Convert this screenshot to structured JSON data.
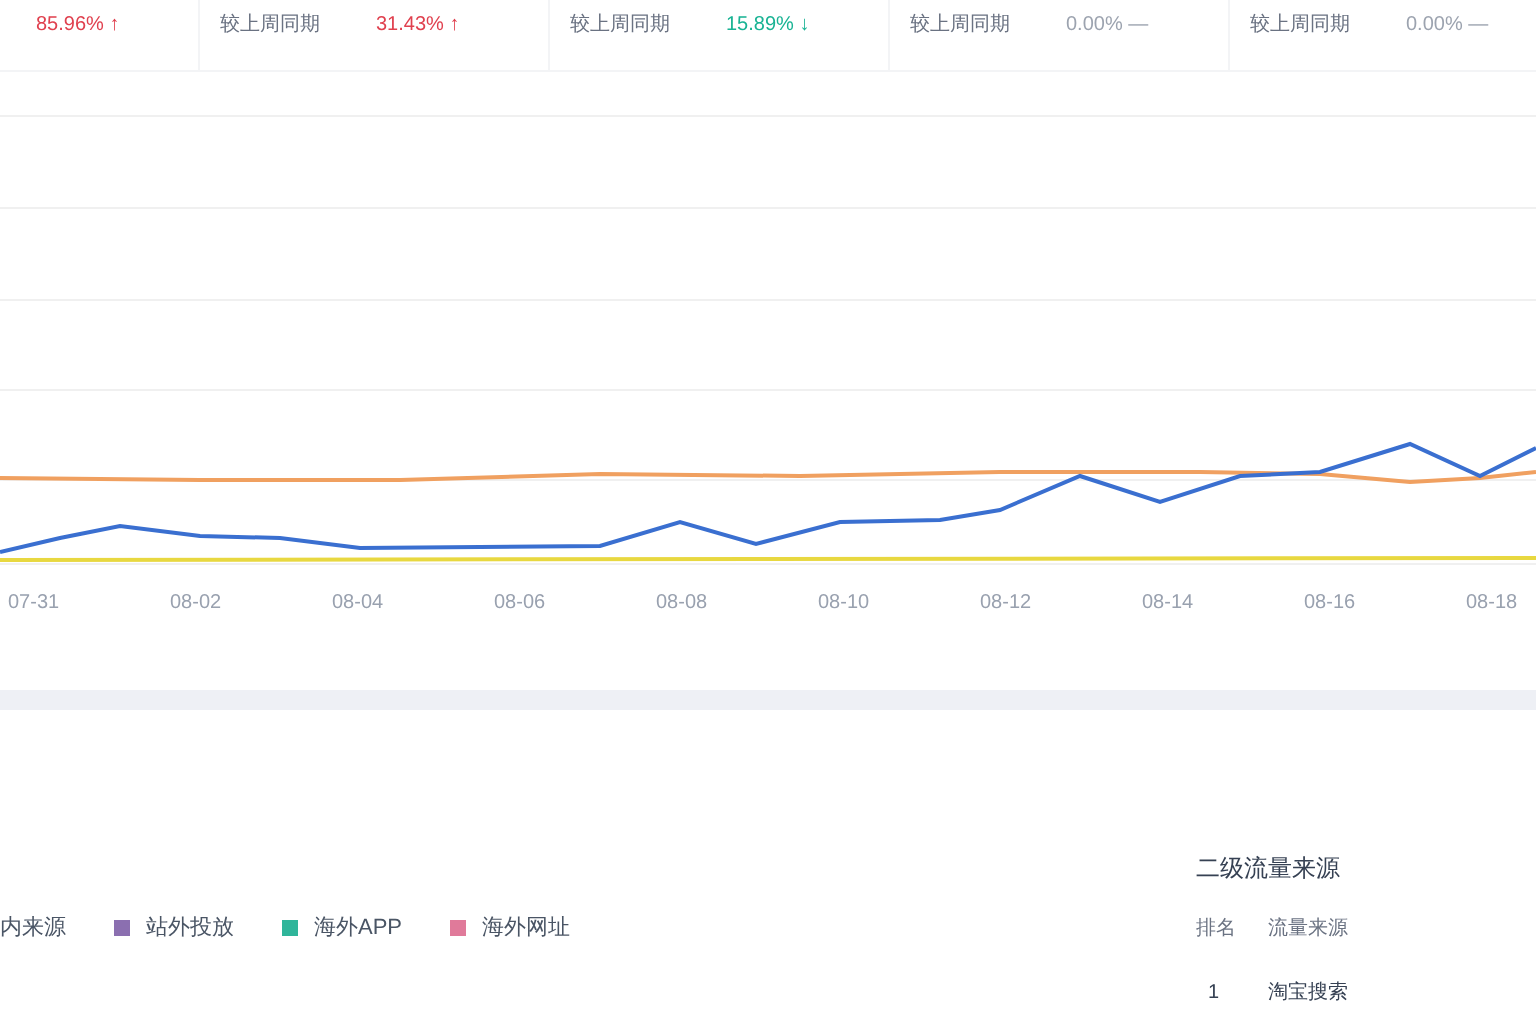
{
  "stat_cards": [
    {
      "change": "85.96%",
      "arrow": "↑",
      "color": "#e0414f"
    },
    {
      "label": "较上周同期",
      "change": "31.43%",
      "arrow": "↑",
      "color": "#e0414f"
    },
    {
      "label": "较上周同期",
      "change": "15.89%",
      "arrow": "↓",
      "color": "#19b394"
    },
    {
      "label": "较上周同期",
      "change": "0.00%",
      "arrow": "—",
      "color": "#9ca3af"
    },
    {
      "label": "较上周同期",
      "change": "0.00%",
      "arrow": "—",
      "color": "#9ca3af"
    }
  ],
  "trend_chart": {
    "x_labels": [
      "07-31",
      "08-02",
      "08-04",
      "08-06",
      "08-08",
      "08-10",
      "08-12",
      "08-14",
      "08-16",
      "08-18"
    ]
  },
  "legend": [
    {
      "label": "内来源"
    },
    {
      "label": "站外投放",
      "color": "#8b6fb0"
    },
    {
      "label": "海外APP",
      "color": "#2fb59a"
    },
    {
      "label": "海外网址",
      "color": "#e07a9a"
    }
  ],
  "secondary_sources": {
    "title": "二级流量来源",
    "columns": [
      "排名",
      "流量来源"
    ],
    "rows": [
      [
        "1",
        "淘宝搜索"
      ]
    ]
  }
}
